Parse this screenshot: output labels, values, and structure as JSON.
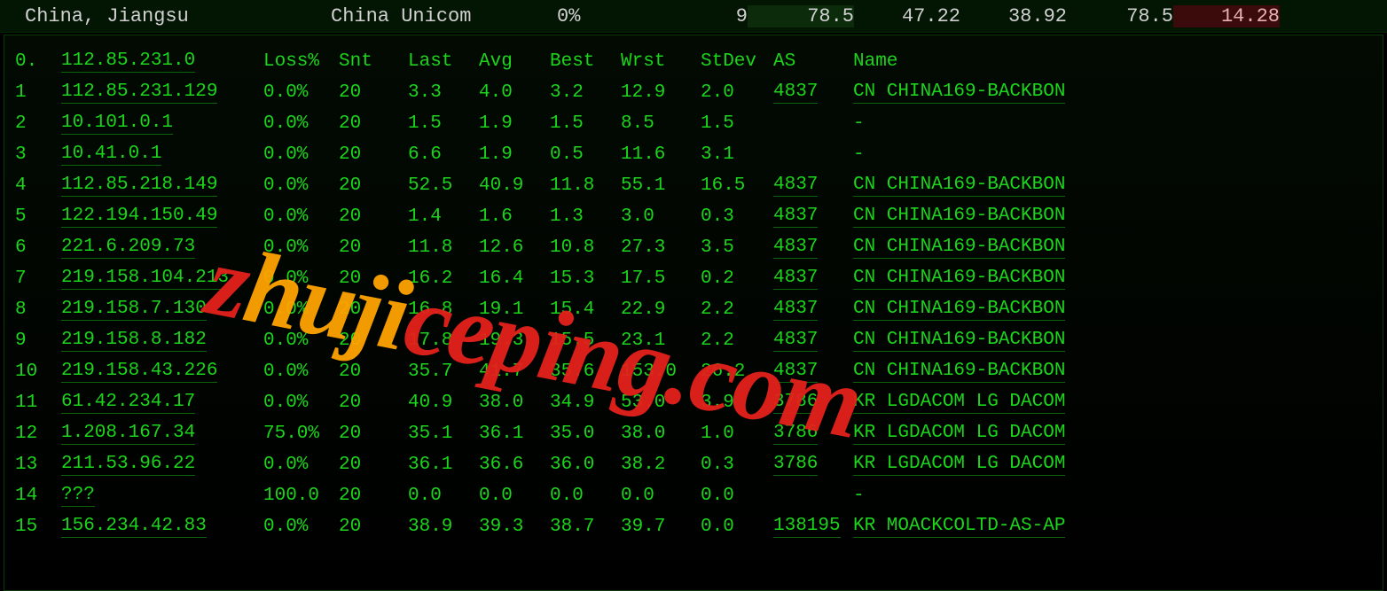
{
  "topbar": {
    "location": "China, Jiangsu",
    "isp": "China Unicom",
    "loss": "0%",
    "count": "9",
    "stats": [
      "78.5",
      "47.22",
      "38.92",
      "78.5",
      "14.28"
    ]
  },
  "headers": {
    "hop": "0.",
    "ip": "112.85.231.0",
    "loss": "Loss%",
    "snt": "Snt",
    "last": "Last",
    "avg": "Avg",
    "best": "Best",
    "wrst": "Wrst",
    "stdev": "StDev",
    "as": "AS",
    "name": "Name"
  },
  "rows": [
    {
      "hop": "1",
      "ip": "112.85.231.129",
      "loss": "0.0%",
      "snt": "20",
      "last": "3.3",
      "avg": "4.0",
      "best": "3.2",
      "wrst": "12.9",
      "stdev": "2.0",
      "as": "4837",
      "name": "CN CHINA169-BACKBON"
    },
    {
      "hop": "2",
      "ip": "10.101.0.1",
      "loss": "0.0%",
      "snt": "20",
      "last": "1.5",
      "avg": "1.9",
      "best": "1.5",
      "wrst": "8.5",
      "stdev": "1.5",
      "as": "",
      "name": "-"
    },
    {
      "hop": "3",
      "ip": "10.41.0.1",
      "loss": "0.0%",
      "snt": "20",
      "last": "6.6",
      "avg": "1.9",
      "best": "0.5",
      "wrst": "11.6",
      "stdev": "3.1",
      "as": "",
      "name": "-"
    },
    {
      "hop": "4",
      "ip": "112.85.218.149",
      "loss": "0.0%",
      "snt": "20",
      "last": "52.5",
      "avg": "40.9",
      "best": "11.8",
      "wrst": "55.1",
      "stdev": "16.5",
      "as": "4837",
      "name": "CN CHINA169-BACKBON"
    },
    {
      "hop": "5",
      "ip": "122.194.150.49",
      "loss": "0.0%",
      "snt": "20",
      "last": "1.4",
      "avg": "1.6",
      "best": "1.3",
      "wrst": "3.0",
      "stdev": "0.3",
      "as": "4837",
      "name": "CN CHINA169-BACKBON"
    },
    {
      "hop": "6",
      "ip": "221.6.209.73",
      "loss": "0.0%",
      "snt": "20",
      "last": "11.8",
      "avg": "12.6",
      "best": "10.8",
      "wrst": "27.3",
      "stdev": "3.5",
      "as": "4837",
      "name": "CN CHINA169-BACKBON"
    },
    {
      "hop": "7",
      "ip": "219.158.104.213",
      "loss": "0.0%",
      "snt": "20",
      "last": "16.2",
      "avg": "16.4",
      "best": "15.3",
      "wrst": "17.5",
      "stdev": "0.2",
      "as": "4837",
      "name": "CN CHINA169-BACKBON"
    },
    {
      "hop": "8",
      "ip": "219.158.7.130",
      "loss": "0.0%",
      "snt": "20",
      "last": "16.8",
      "avg": "19.1",
      "best": "15.4",
      "wrst": "22.9",
      "stdev": "2.2",
      "as": "4837",
      "name": "CN CHINA169-BACKBON"
    },
    {
      "hop": "9",
      "ip": "219.158.8.182",
      "loss": "0.0%",
      "snt": "20",
      "last": "17.8",
      "avg": "19.3",
      "best": "15.5",
      "wrst": "23.1",
      "stdev": "2.2",
      "as": "4837",
      "name": "CN CHINA169-BACKBON"
    },
    {
      "hop": "10",
      "ip": "219.158.43.226",
      "loss": "0.0%",
      "snt": "20",
      "last": "35.7",
      "avg": "41.7",
      "best": "35.6",
      "wrst": "153.0",
      "stdev": "26.2",
      "as": "4837",
      "name": "CN CHINA169-BACKBON"
    },
    {
      "hop": "11",
      "ip": "61.42.234.17",
      "loss": "0.0%",
      "snt": "20",
      "last": "40.9",
      "avg": "38.0",
      "best": "34.9",
      "wrst": "53.0",
      "stdev": "3.9",
      "as": "3786",
      "name": "KR LGDACOM LG DACOM"
    },
    {
      "hop": "12",
      "ip": "1.208.167.34",
      "loss": "75.0%",
      "snt": "20",
      "last": "35.1",
      "avg": "36.1",
      "best": "35.0",
      "wrst": "38.0",
      "stdev": "1.0",
      "as": "3786",
      "name": "KR LGDACOM LG DACOM"
    },
    {
      "hop": "13",
      "ip": "211.53.96.22",
      "loss": "0.0%",
      "snt": "20",
      "last": "36.1",
      "avg": "36.6",
      "best": "36.0",
      "wrst": "38.2",
      "stdev": "0.3",
      "as": "3786",
      "name": "KR LGDACOM LG DACOM"
    },
    {
      "hop": "14",
      "ip": "???",
      "loss": "100.0",
      "snt": "20",
      "last": "0.0",
      "avg": "0.0",
      "best": "0.0",
      "wrst": "0.0",
      "stdev": "0.0",
      "as": "",
      "name": "-"
    },
    {
      "hop": "15",
      "ip": "156.234.42.83",
      "loss": "0.0%",
      "snt": "20",
      "last": "38.9",
      "avg": "39.3",
      "best": "38.7",
      "wrst": "39.7",
      "stdev": "0.0",
      "as": "138195",
      "name": "KR MOACKCOLTD-AS-AP"
    }
  ],
  "watermark": {
    "pre": "z",
    "mid": "huji",
    "post": "ceping.com"
  }
}
